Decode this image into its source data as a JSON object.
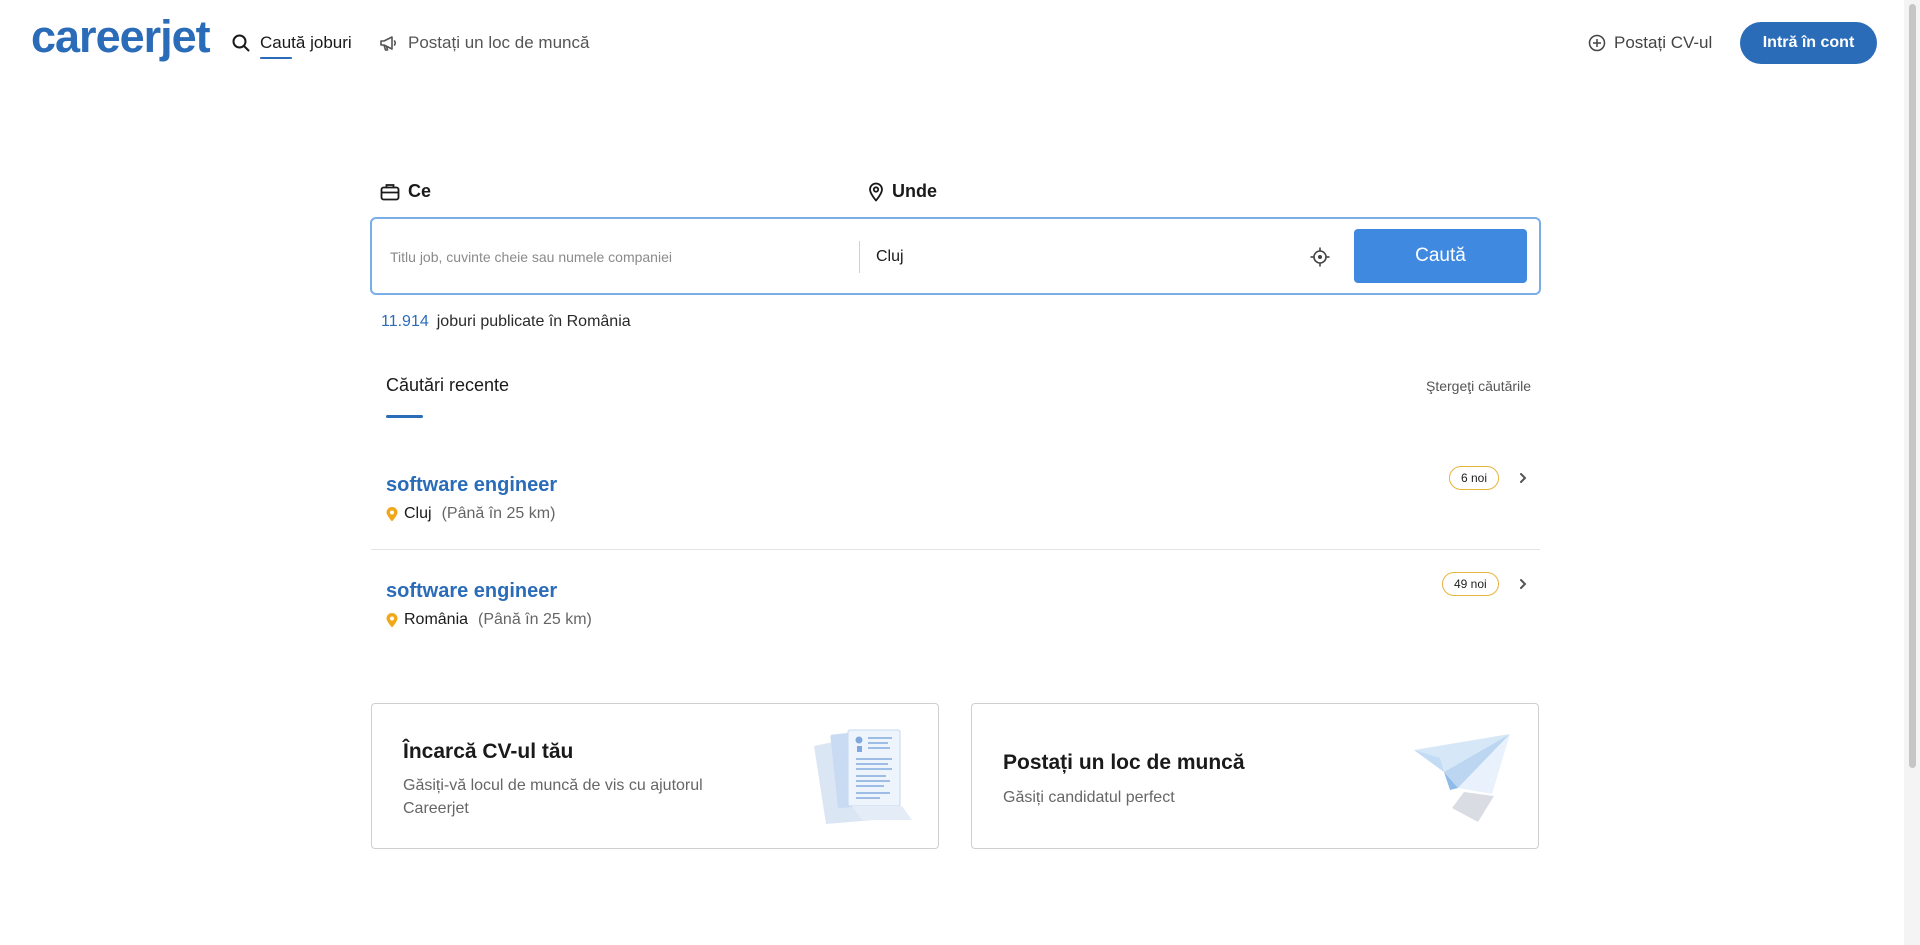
{
  "header": {
    "logo": "careerjet",
    "nav": {
      "search_jobs": "Caută joburi",
      "post_job": "Postați un loc de muncă"
    },
    "post_cv": "Postați CV-ul",
    "login": "Intră în cont"
  },
  "search": {
    "what_label": "Ce",
    "where_label": "Unde",
    "what_placeholder": "Titlu job, cuvinte cheie sau numele companiei",
    "what_value": "",
    "where_value": "Cluj",
    "submit_label": "Caută"
  },
  "jobs_count": {
    "number": "11.914",
    "text": "joburi publicate în România"
  },
  "recent": {
    "title": "Căutări recente",
    "clear_label": "Ştergeţi căutările",
    "items": [
      {
        "query": "software engineer",
        "location": "Cluj",
        "range": "(Până în 25 km)",
        "badge": "6 noi"
      },
      {
        "query": "software engineer",
        "location": "România",
        "range": "(Până în 25 km)",
        "badge": "49 noi"
      }
    ]
  },
  "cards": {
    "cv": {
      "title": "Încarcă CV-ul tău",
      "desc": "Găsiți-vă locul de muncă de vis cu ajutorul Careerjet"
    },
    "job": {
      "title": "Postați un loc de muncă",
      "desc": "Găsiți candidatul perfect"
    }
  },
  "colors": {
    "brand": "#2b6cb9",
    "search_button": "#3f8ae0",
    "badge_border": "#e6b53c",
    "pin": "#f0a81a"
  },
  "icons": [
    "search-icon",
    "megaphone-icon",
    "plus-circle-icon",
    "briefcase-icon",
    "location-pin-icon",
    "crosshair-icon",
    "chevron-right-icon",
    "cv-document-illustration",
    "paper-plane-illustration"
  ]
}
